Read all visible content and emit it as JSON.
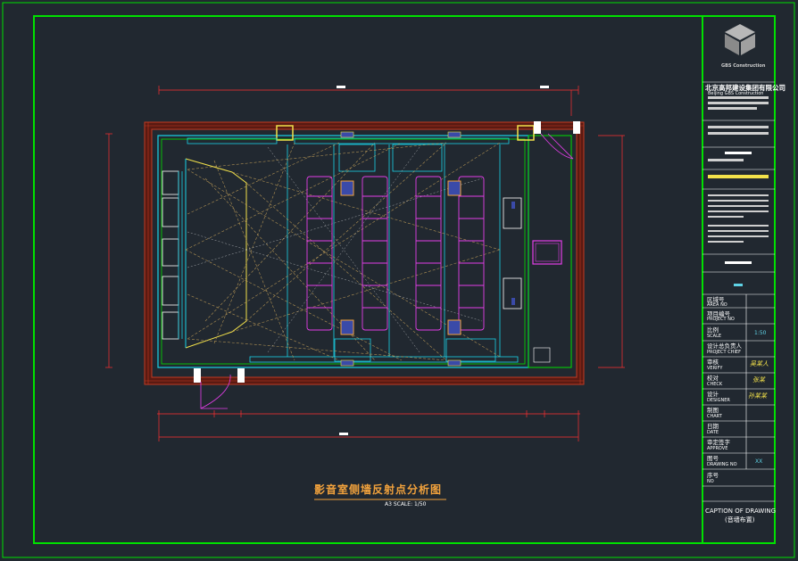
{
  "drawing": {
    "title": "影音室侧墙反射点分析图",
    "scale": "A3 SCALE: 1/50"
  },
  "title_block": {
    "company_cn": "北京高邦建设集团有限公司",
    "company_en": "Beijing GBS Construction",
    "logo_sub": "GBS Construction",
    "caption_en": "CAPTION OF DRAWING",
    "caption_cn": "(音墙布置)",
    "rows": [
      {
        "cn": "区域号",
        "en": "AREA NO",
        "value": ""
      },
      {
        "cn": "项目编号",
        "en": "PROJECT NO",
        "value": ""
      },
      {
        "cn": "比例",
        "en": "SCALE",
        "value": "1:50"
      },
      {
        "cn": "设计总负责人",
        "en": "PROJECT CHIEF",
        "value": ""
      },
      {
        "cn": "审核",
        "en": "VERIFY",
        "value": "吴某人"
      },
      {
        "cn": "校对",
        "en": "CHECK",
        "value": "张某"
      },
      {
        "cn": "设计",
        "en": "DESIGNER",
        "value": "孙某某"
      },
      {
        "cn": "制图",
        "en": "CHART",
        "value": ""
      },
      {
        "cn": "日期",
        "en": "DATE",
        "value": ""
      },
      {
        "cn": "审定签字",
        "en": "APPROVE",
        "value": ""
      },
      {
        "cn": "图号",
        "en": "DRAWING NO",
        "value": "XX"
      },
      {
        "cn": "序号",
        "en": "NO",
        "value": ""
      }
    ]
  },
  "colors": {
    "background": "#212830",
    "border": "#00e000",
    "wall": "#7a2418",
    "cyan": "#19d3e8",
    "magenta": "#e33ee8",
    "yellow": "#f2e14a",
    "orange": "#f2a23c"
  }
}
